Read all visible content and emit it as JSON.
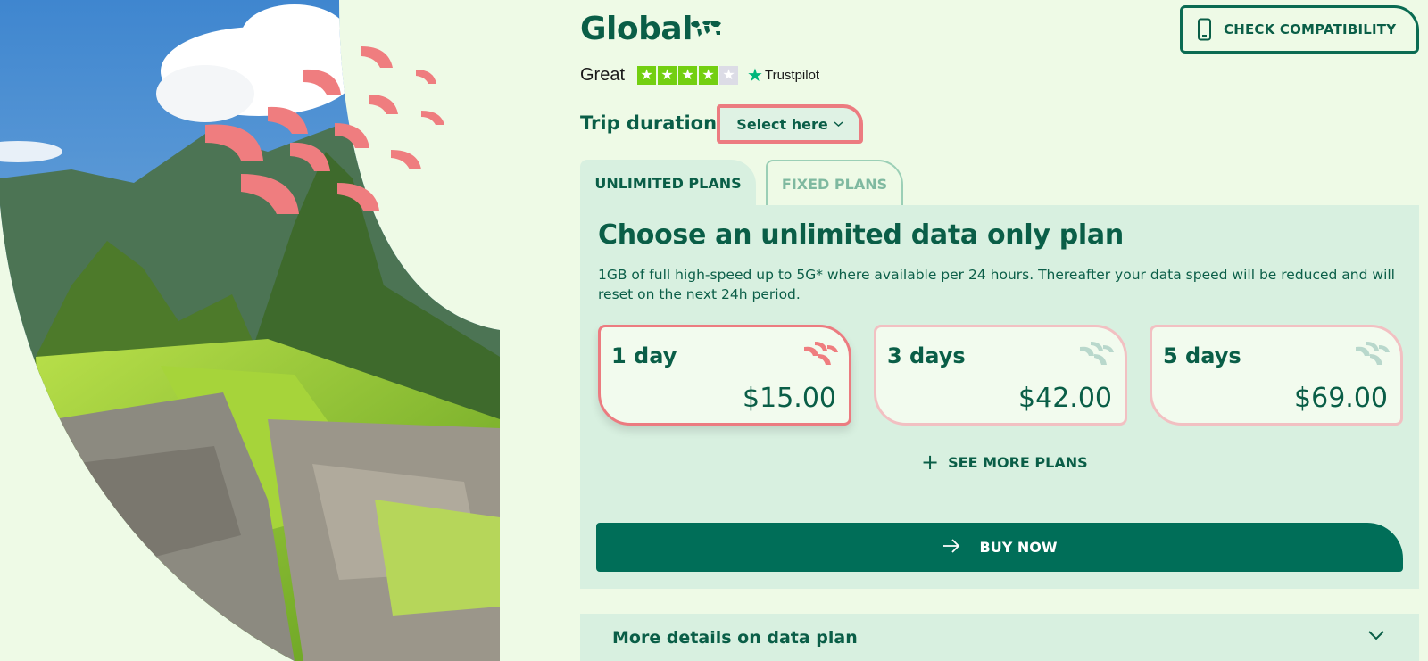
{
  "header": {
    "title": "Global",
    "compat_button": "CHECK COMPATIBILITY"
  },
  "rating": {
    "label": "Great",
    "stars": 4,
    "max_stars": 5,
    "provider": "Trustpilot"
  },
  "trip": {
    "label": "Trip duration",
    "select_label": "Select here"
  },
  "tabs": [
    {
      "label": "UNLIMITED PLANS",
      "active": true
    },
    {
      "label": "FIXED PLANS",
      "active": false
    }
  ],
  "panel": {
    "heading": "Choose an unlimited data only plan",
    "description": "1GB of full high-speed up to 5G* where available per 24 hours. Thereafter your data speed will be reduced and will reset on the next 24h period."
  },
  "plans": [
    {
      "days": "1 day",
      "price": "$15.00",
      "selected": true
    },
    {
      "days": "3 days",
      "price": "$42.00",
      "selected": false
    },
    {
      "days": "5 days",
      "price": "$69.00",
      "selected": false
    }
  ],
  "see_more": "SEE MORE PLANS",
  "buy_button": "BUY NOW",
  "details_label": "More details on data plan",
  "colors": {
    "background": "#eefae6",
    "panel": "#d8f0e0",
    "primary": "#006e58",
    "accent_coral": "#ec7b80",
    "trustpilot_green": "#73cf11"
  }
}
